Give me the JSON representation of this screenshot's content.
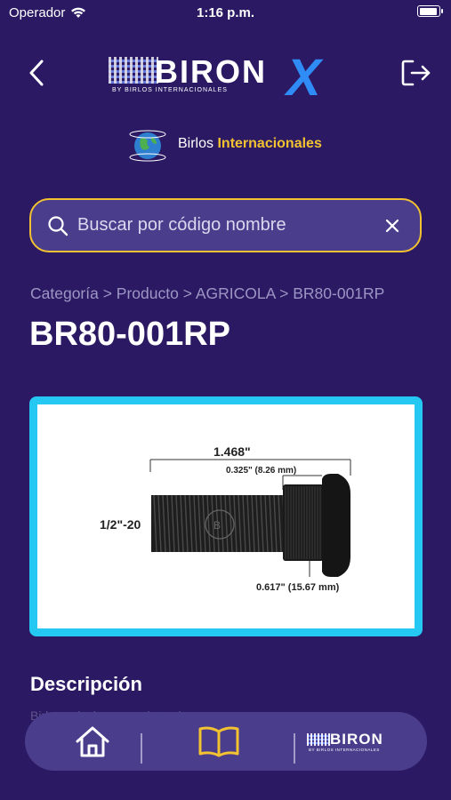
{
  "status_bar": {
    "carrier": "Operador",
    "time": "1:16 p.m."
  },
  "header": {
    "brand_name": "BIRONX",
    "brand_word": "BIRON",
    "brand_x": "X",
    "brand_tagline": "BY BIRLOS INTERNACIONALES",
    "sponsor_globe_text": "BIRLOS INTERNACIONALES",
    "sponsor_prefix": "Birlos",
    "sponsor_accent": "Internacionales"
  },
  "search": {
    "placeholder": "Buscar por código nombre",
    "value": ""
  },
  "breadcrumb": "Categoría > Producto > AGRICOLA > BR80-001RP",
  "product": {
    "title": "BR80-001RP",
    "image": {
      "overall_length": "1.468\"",
      "knurl_length": "0.325\" (8.26 mm)",
      "thread": "1/2\"-20",
      "knurl_diameter": "0.617\" (15.67 mm)"
    }
  },
  "description": {
    "heading": "Descripción",
    "text": "Birlo agrícola con moleteado"
  },
  "bottom_nav": {
    "brand_word": "BIRON",
    "brand_sub": "BY BIRLOS INTERNACIONALES"
  },
  "colors": {
    "background": "#2b1a63",
    "accent_yellow": "#f2c230",
    "card_border": "#25c8f3",
    "brand_blue": "#2f8cf6"
  }
}
